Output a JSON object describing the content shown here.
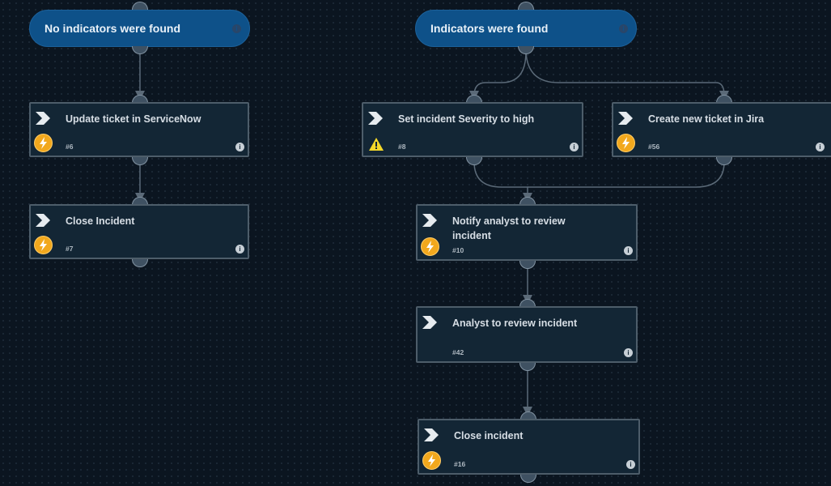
{
  "colors": {
    "background": "#0b1520",
    "condition_fill": "#0e5189",
    "task_fill": "#132635",
    "task_border": "#4d5d6a",
    "automation_badge": "#f2a81d",
    "warning_badge": "#f5d829",
    "edge": "#5b6a78"
  },
  "conditions": [
    {
      "id": "cond-no-indicators",
      "label": "No indicators were found",
      "icon": "info-icon"
    },
    {
      "id": "cond-indicators",
      "label": "Indicators were found",
      "icon": "info-icon"
    }
  ],
  "tasks": [
    {
      "id": "task-6",
      "title": "Update ticket in ServiceNow",
      "number": "#6",
      "badge": "automation-bolt-icon"
    },
    {
      "id": "task-7",
      "title": "Close Incident",
      "number": "#7",
      "badge": "automation-bolt-icon"
    },
    {
      "id": "task-8",
      "title": "Set incident Severity to high",
      "number": "#8",
      "badge": "warning-icon"
    },
    {
      "id": "task-56",
      "title": "Create new ticket in Jira",
      "number": "#56",
      "badge": "automation-bolt-icon"
    },
    {
      "id": "task-10",
      "title": "Notify analyst to review incident",
      "number": "#10",
      "badge": "automation-bolt-icon"
    },
    {
      "id": "task-42",
      "title": "Analyst to review incident",
      "number": "#42",
      "badge": "none"
    },
    {
      "id": "task-16",
      "title": "Close incident",
      "number": "#16",
      "badge": "automation-bolt-icon"
    }
  ],
  "edges": [
    {
      "from": "No indicators were found",
      "to": "#6"
    },
    {
      "from": "#6",
      "to": "#7"
    },
    {
      "from": "Indicators were found",
      "to": "#8"
    },
    {
      "from": "Indicators were found",
      "to": "#56"
    },
    {
      "from": "#8",
      "to": "#10"
    },
    {
      "from": "#56",
      "to": "#10"
    },
    {
      "from": "#10",
      "to": "#42"
    },
    {
      "from": "#42",
      "to": "#16"
    }
  ]
}
